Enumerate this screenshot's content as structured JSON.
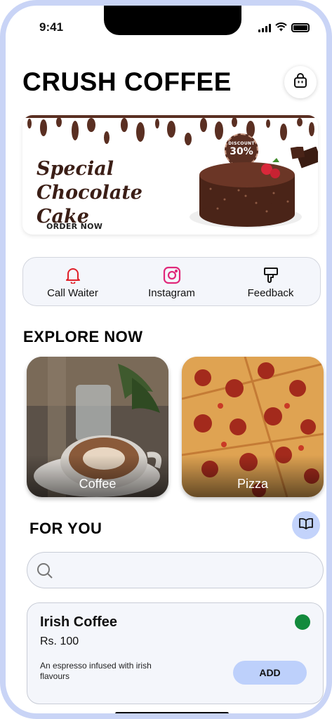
{
  "status_bar": {
    "time": "9:41"
  },
  "header": {
    "brand": "CRUSH COFFEE",
    "cart_icon": "shopping-bag-icon"
  },
  "banner": {
    "title_line1": "Special",
    "title_line2": "Chocolate Cake",
    "cta": "ORDER NOW",
    "discount_label": "DISCOUNT",
    "discount_value": "30%"
  },
  "quick_actions": [
    {
      "label": "Call Waiter",
      "icon": "bell-icon",
      "color": "#e0202a"
    },
    {
      "label": "Instagram",
      "icon": "instagram-icon",
      "color": "#e0287a"
    },
    {
      "label": "Feedback",
      "icon": "thumbs-down-icon",
      "color": "#111111"
    }
  ],
  "explore": {
    "title": "EXPLORE NOW",
    "tiles": [
      {
        "label": "Coffee"
      },
      {
        "label": "Pizza"
      }
    ]
  },
  "for_you": {
    "title": "FOR YOU",
    "menu_icon": "open-book-icon",
    "search": {
      "placeholder": "",
      "value": ""
    }
  },
  "items": [
    {
      "name": "Irish Coffee",
      "price": "Rs. 100",
      "description": "An espresso infused with irish flavours",
      "add_label": "ADD",
      "veg_color": "#138a3c"
    }
  ],
  "colors": {
    "accent": "#bdd0fb",
    "frame": "#c9d4f6",
    "banner_brown": "#5a2f22"
  }
}
